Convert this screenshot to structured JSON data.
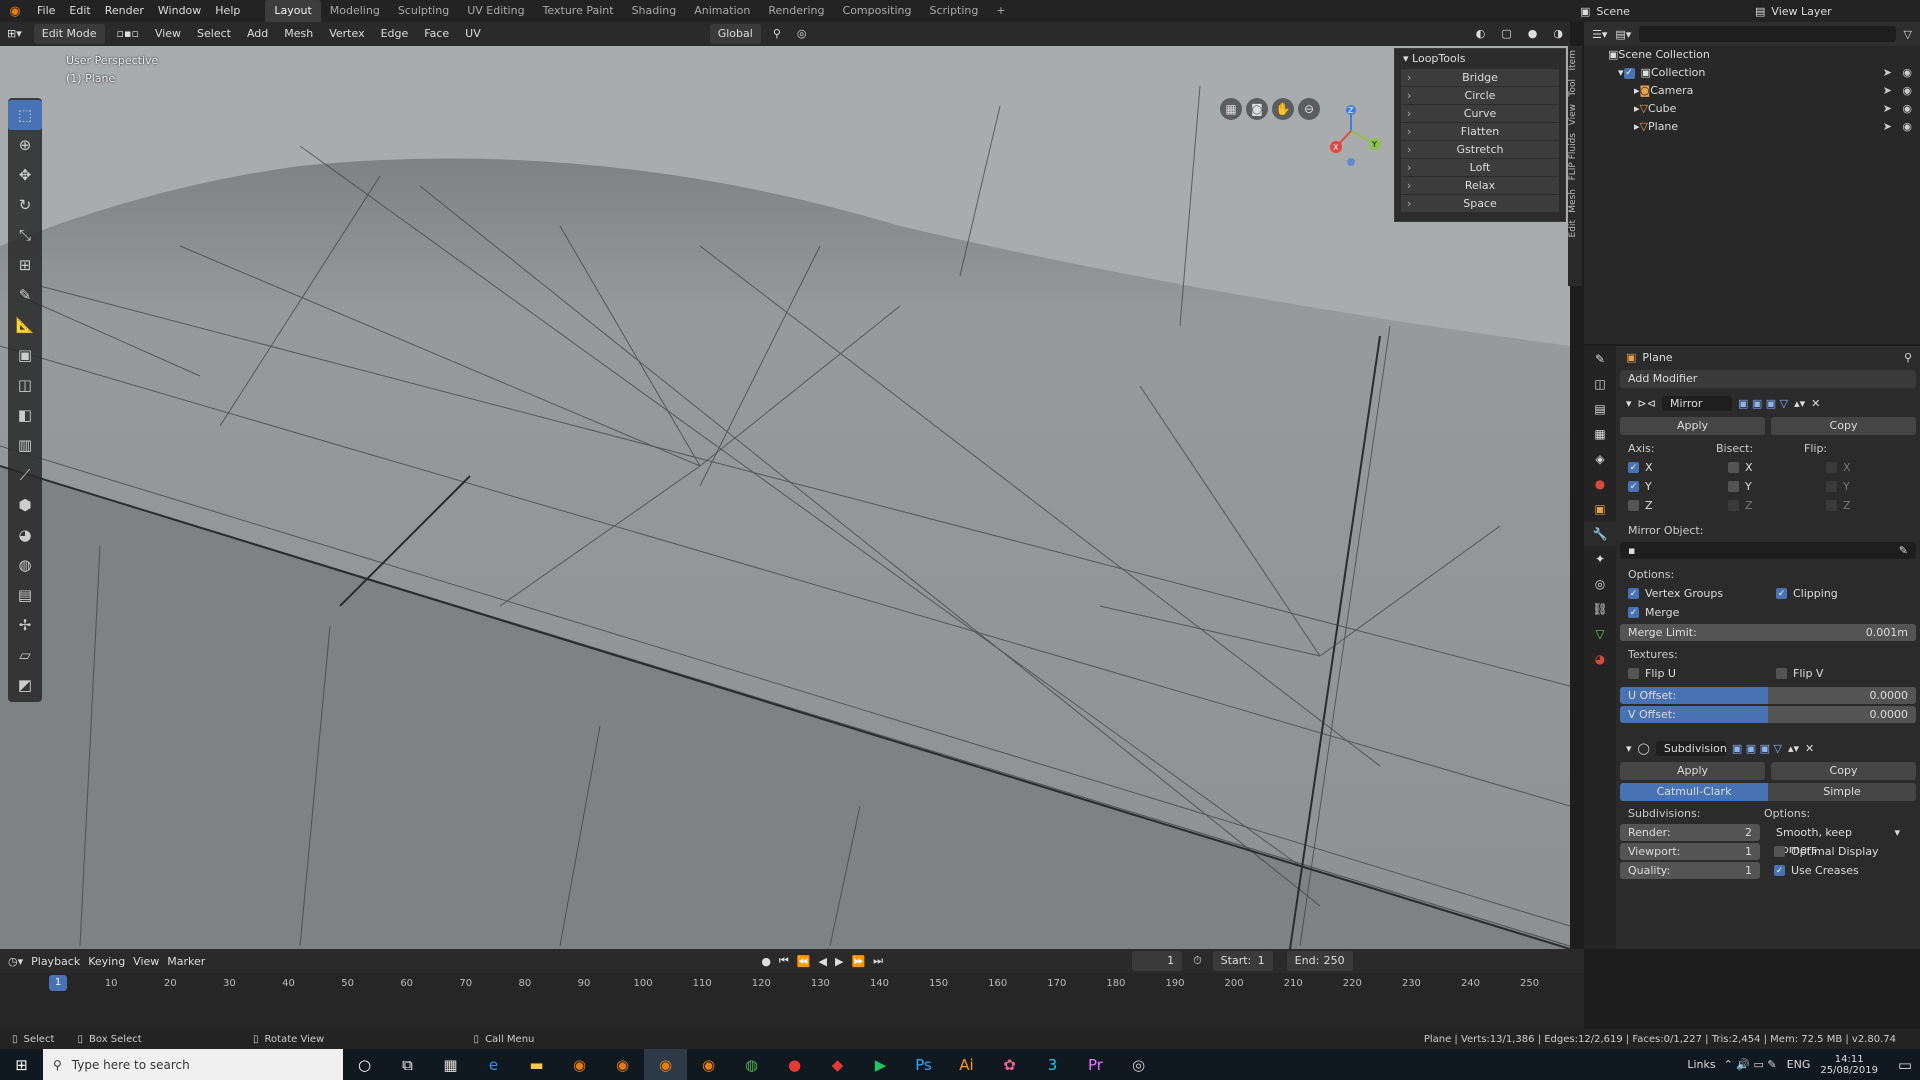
{
  "topmenu": {
    "items": [
      "File",
      "Edit",
      "Render",
      "Window",
      "Help"
    ]
  },
  "workspaces": {
    "tabs": [
      "Layout",
      "Modeling",
      "Sculpting",
      "UV Editing",
      "Texture Paint",
      "Shading",
      "Animation",
      "Rendering",
      "Compositing",
      "Scripting"
    ],
    "active": "Layout",
    "add": "+"
  },
  "scene": {
    "label": "Scene",
    "view_layer": "View Layer"
  },
  "vpheader": {
    "mode": "Edit Mode",
    "menus": [
      "View",
      "Select",
      "Add",
      "Mesh",
      "Vertex",
      "Edge",
      "Face",
      "UV"
    ],
    "orientation": "Global"
  },
  "viewport": {
    "view_name": "User Perspective",
    "object_name": "(1) Plane"
  },
  "gizmo": {
    "x": "X",
    "y": "Y",
    "z": "Z",
    "colors": {
      "x": "#e0453f",
      "y": "#8bc34a",
      "z": "#3f7de0"
    }
  },
  "looptools": {
    "title": "LoopTools",
    "items": [
      "Bridge",
      "Circle",
      "Curve",
      "Flatten",
      "Gstretch",
      "Loft",
      "Relax",
      "Space"
    ]
  },
  "sidetabs": [
    "Item",
    "Tool",
    "View",
    "FLIP Fluids",
    "Mesh",
    "Edit"
  ],
  "outliner": {
    "root": "Scene Collection",
    "collection": "Collection",
    "objects": [
      "Camera",
      "Cube",
      "Plane"
    ]
  },
  "properties": {
    "object": "Plane",
    "add_modifier": "Add Modifier",
    "mirror": {
      "name": "Mirror",
      "apply": "Apply",
      "copy": "Copy",
      "axis_label": "Axis:",
      "bisect_label": "Bisect:",
      "flip_label": "Flip:",
      "axes": [
        "X",
        "Y",
        "Z"
      ],
      "mirror_object": "Mirror Object:",
      "options_label": "Options:",
      "vertex_groups": "Vertex Groups",
      "clipping": "Clipping",
      "merge": "Merge",
      "merge_limit_label": "Merge Limit:",
      "merge_limit": "0.001m",
      "textures_label": "Textures:",
      "flip_u": "Flip U",
      "flip_v": "Flip V",
      "u_offset_label": "U Offset:",
      "u_offset": "0.0000",
      "v_offset_label": "V Offset:",
      "v_offset": "0.0000"
    },
    "subdivision": {
      "name": "Subdivision",
      "apply": "Apply",
      "copy": "Copy",
      "catmull": "Catmull-Clark",
      "simple": "Simple",
      "subdivisions_label": "Subdivisions:",
      "options_label": "Options:",
      "render_label": "Render:",
      "render": "2",
      "viewport_label": "Viewport:",
      "viewport": "1",
      "quality_label": "Quality:",
      "quality": "1",
      "uv_smooth": "Smooth, keep corners",
      "optimal_display": "Optimal Display",
      "use_creases": "Use Creases"
    }
  },
  "timeline": {
    "menus": [
      "Playback",
      "Keying",
      "View",
      "Marker"
    ],
    "current": "1",
    "start_label": "Start:",
    "start": "1",
    "end_label": "End:",
    "end": "250",
    "ticks": [
      "1",
      "10",
      "20",
      "30",
      "40",
      "50",
      "60",
      "70",
      "80",
      "90",
      "100",
      "110",
      "120",
      "130",
      "140",
      "150",
      "160",
      "170",
      "180",
      "190",
      "200",
      "210",
      "220",
      "230",
      "240",
      "250"
    ]
  },
  "statusbar": {
    "select": "Select",
    "box_select": "Box Select",
    "rotate": "Rotate View",
    "call_menu": "Call Menu",
    "stats": "Plane | Verts:13/1,386 | Edges:12/2,619 | Faces:0/1,227 | Tris:2,454 | Mem: 72.5 MB | v2.80.74"
  },
  "taskbar": {
    "search_placeholder": "Type here to search",
    "links": "Links",
    "lang": "ENG",
    "time": "14:11",
    "date": "25/08/2019"
  }
}
